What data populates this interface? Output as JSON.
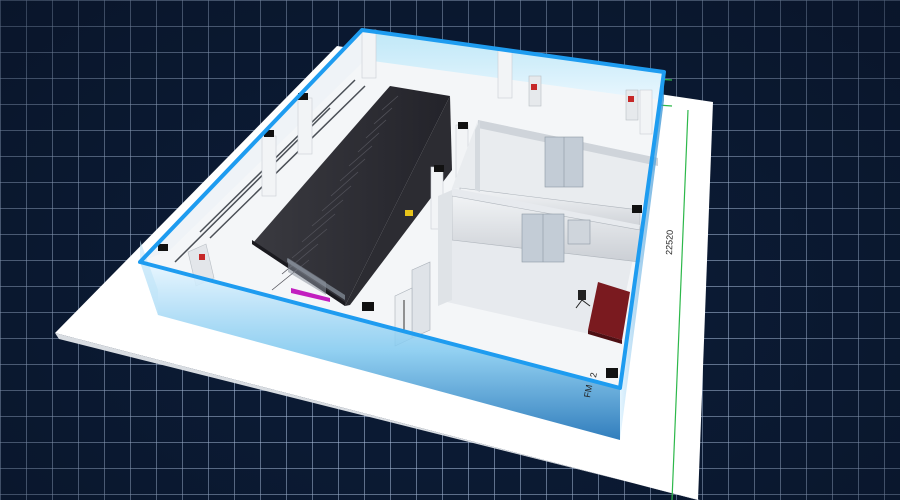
{
  "scene": {
    "dimension_side": "22520",
    "dimension_front_partial": "2",
    "floor_label_partial": "FM"
  },
  "colors": {
    "grid_bg": "#0b1a33",
    "grid_line": "#aabedc",
    "outline_blue": "#1e9cf0",
    "dimension_green": "#2db84a",
    "rack_dark": "#2b2b30",
    "sofa_red": "#7a1a1f"
  }
}
